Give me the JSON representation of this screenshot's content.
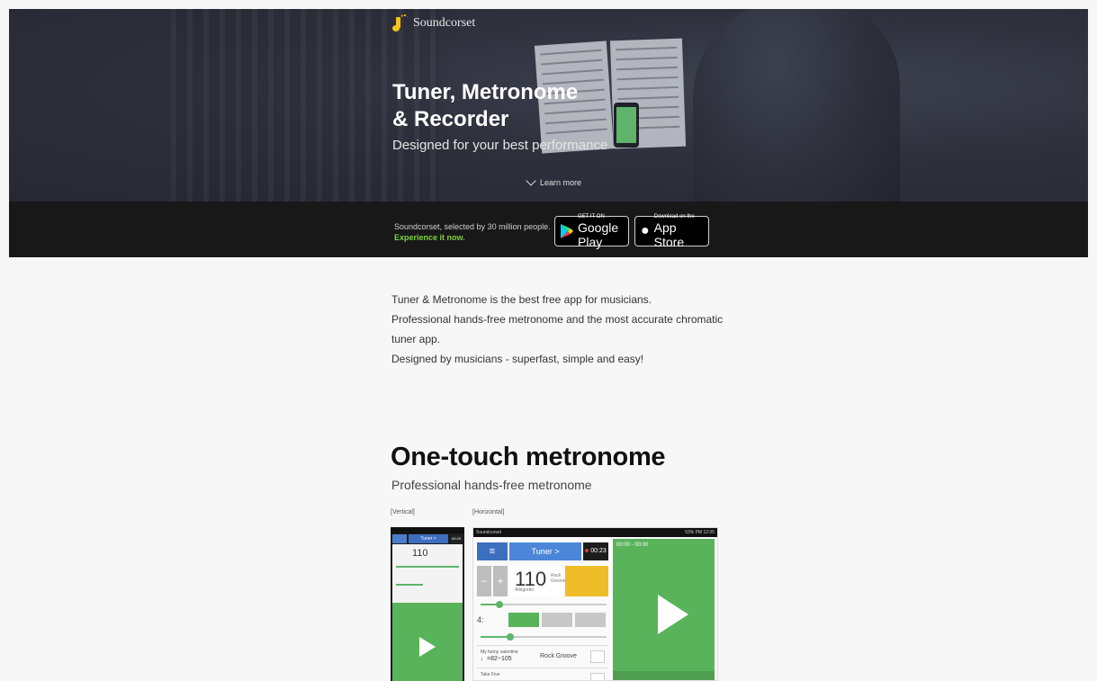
{
  "brand": {
    "name": "Soundcorset",
    "accent": "#f4c21a"
  },
  "hero": {
    "title_line1": "Tuner, Metronome",
    "title_line2": "& Recorder",
    "subtitle": "Designed for your best performance",
    "learn_more": "Learn more"
  },
  "band": {
    "text": "Soundcorset, selected by 30 million people.",
    "cta": "Experience it now.",
    "cta_color": "#7bd23c",
    "google_play": {
      "small": "GET IT ON",
      "big": "Google Play"
    },
    "app_store": {
      "small": "Download on the",
      "big": "App Store"
    }
  },
  "intro": {
    "line1": "Tuner & Metronome is the best free app for musicians.",
    "line2": "Professional hands-free metronome and the most accurate chromatic",
    "line3": "tuner app.",
    "line4": "Designed by musicians - superfast, simple and easy!"
  },
  "section": {
    "title": "One-touch metronome",
    "subtitle": "Professional hands-free metronome",
    "label_vertical": "[Vertical]",
    "label_horizontal": "[Horizontal]"
  },
  "vertical_phone": {
    "tuner": "Tuner >",
    "rec": "00:23",
    "bpm": "110"
  },
  "horizontal_phone": {
    "app_name": "Soundcorset",
    "status_right": "53% PM 12:05",
    "menu": "≡",
    "tuner": "Tuner >",
    "rec": "00:23",
    "minus": "−",
    "plus": "+",
    "bpm": "110",
    "tempo_name": "Allegretto",
    "groove": "Rock Groove",
    "beats": "4:",
    "timer": "00:00 - 00:00",
    "items": [
      {
        "title": "My funny valentine",
        "value": "♩=82~105",
        "rhythm": "Rock Groove"
      },
      {
        "title": "Take Five",
        "value": "",
        "rhythm": ""
      }
    ]
  }
}
